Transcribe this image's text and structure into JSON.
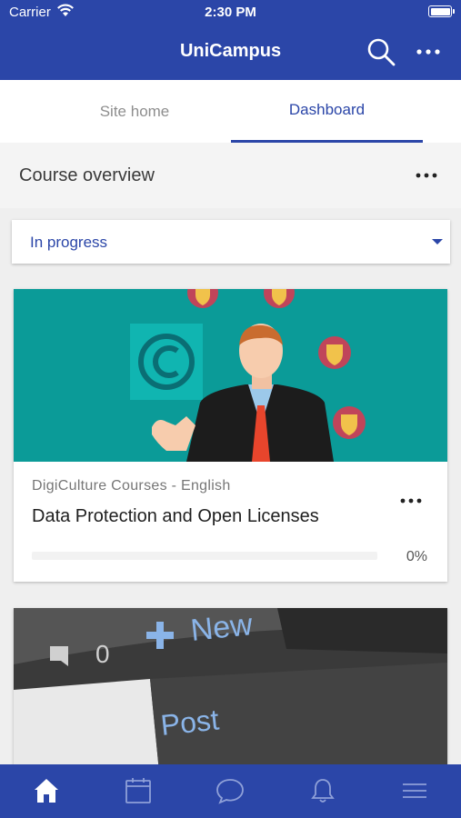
{
  "status_bar": {
    "carrier": "Carrier",
    "time": "2:30 PM"
  },
  "header": {
    "title": "UniCampus",
    "search_icon": "search-icon",
    "more_icon": "more-horizontal-icon"
  },
  "tabs": [
    {
      "label": "Site home",
      "active": false
    },
    {
      "label": "Dashboard",
      "active": true
    }
  ],
  "course_overview": {
    "title": "Course overview",
    "filter": {
      "selected": "In progress"
    }
  },
  "courses": [
    {
      "category": "DigiCulture Courses - English",
      "name": "Data Protection and Open Licenses",
      "progress_text": "0%",
      "progress": 0
    }
  ],
  "bottom_nav": [
    "home-icon",
    "calendar-icon",
    "chat-icon",
    "bell-icon",
    "menu-icon"
  ],
  "colors": {
    "brand": "#2b46a8",
    "teal": "#0b9b98"
  }
}
